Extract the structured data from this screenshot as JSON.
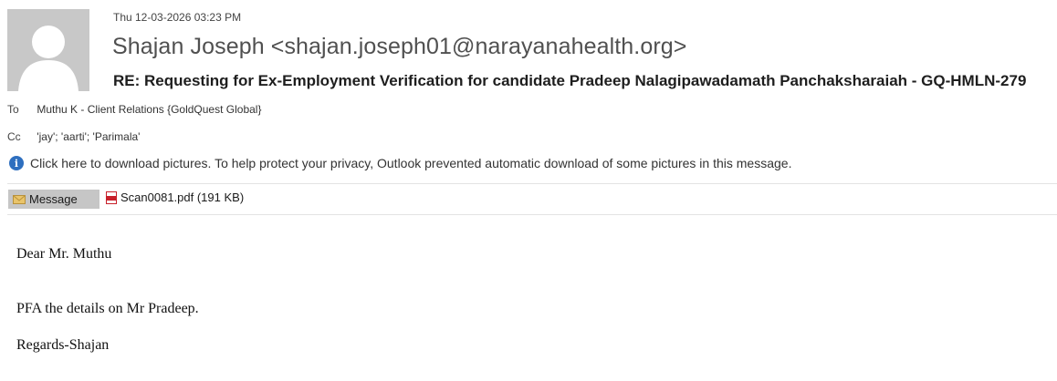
{
  "message": {
    "date": "Thu 12-03-2026 03:23 PM",
    "sender": "Shajan Joseph <shajan.joseph01@narayanahealth.org>",
    "subject": "RE: Requesting for Ex-Employment Verification for candidate Pradeep Nalagipawadamath Panchaksharaiah  - GQ-HMLN-279",
    "to_label": "To",
    "to_value": "Muthu K - Client Relations {GoldQuest Global}",
    "cc_label": "Cc",
    "cc_value": "'jay'; 'aarti'; 'Parimala'",
    "info_bar": "Click here to download pictures. To help protect your privacy, Outlook prevented automatic download of some pictures in this message."
  },
  "attachments_bar": {
    "message_tab_label": "Message",
    "message_tab_icon": "envelope-icon",
    "attachment_label": "Scan0081.pdf (191 KB)",
    "attachment_icon": "pdf-icon"
  },
  "body": {
    "line1": "Dear Mr. Muthu",
    "line2": "PFA the details on Mr Pradeep.",
    "line3": "Regards-Shajan"
  },
  "colors": {
    "info_icon": "#2e6fbf",
    "avatar_bg": "#c8c8c8",
    "tab_bg": "#c6c6c6",
    "pdf_red": "#c8202a"
  }
}
